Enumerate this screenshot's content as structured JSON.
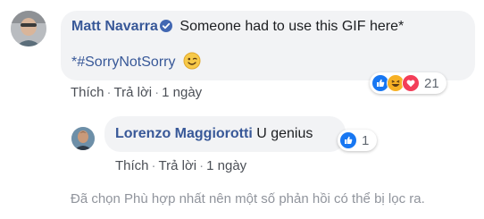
{
  "comment": {
    "author": "Matt Navarra",
    "text": "Someone had to use this GIF here*",
    "text_line2": "*#SorryNotSorry",
    "emoji": "wink-emoji",
    "actions": {
      "like": "Thích",
      "reply": "Trả lời",
      "time": "1 ngày"
    },
    "reactions": {
      "types": [
        "like-icon",
        "haha-icon",
        "love-icon"
      ],
      "count": "21"
    }
  },
  "reply": {
    "author": "Lorenzo Maggiorotti",
    "text": "U genius",
    "actions": {
      "like": "Thích",
      "reply": "Trả lời",
      "time": "1 ngày"
    },
    "reactions": {
      "types": [
        "like-icon"
      ],
      "count": "1"
    }
  },
  "footer_note": "Đã chọn Phù hợp nhất nên một số phản hồi có thể bị lọc ra.",
  "colors": {
    "author": "#385898",
    "bubble": "#f2f3f5",
    "like": "#1877f2",
    "love": "#f33e58",
    "haha": "#f7b125"
  }
}
